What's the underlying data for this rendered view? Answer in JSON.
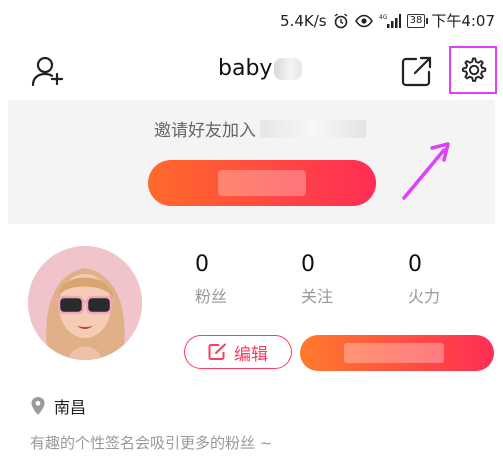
{
  "status_bar": {
    "speed": "5.4K/s",
    "net": "4G",
    "battery": "38",
    "time": "下午4:07"
  },
  "header": {
    "username": "baby"
  },
  "invite": {
    "text": "邀请好友加入"
  },
  "stats": [
    {
      "value": "0",
      "label": "粉丝"
    },
    {
      "value": "0",
      "label": "关注"
    },
    {
      "value": "0",
      "label": "火力"
    }
  ],
  "actions": {
    "edit_label": "编辑"
  },
  "profile": {
    "location": "南昌",
    "bio": "有趣的个性签名会吸引更多的粉丝 ~"
  },
  "colors": {
    "accent": "#ff3a5c",
    "gradient_start": "#ff6a2b",
    "gradient_end": "#ff2d55",
    "highlight": "#e040fb"
  },
  "icons": {
    "add_user": "add-user-icon",
    "share": "share-icon",
    "settings": "gear-icon",
    "location": "location-pin-icon",
    "edit": "edit-icon"
  }
}
